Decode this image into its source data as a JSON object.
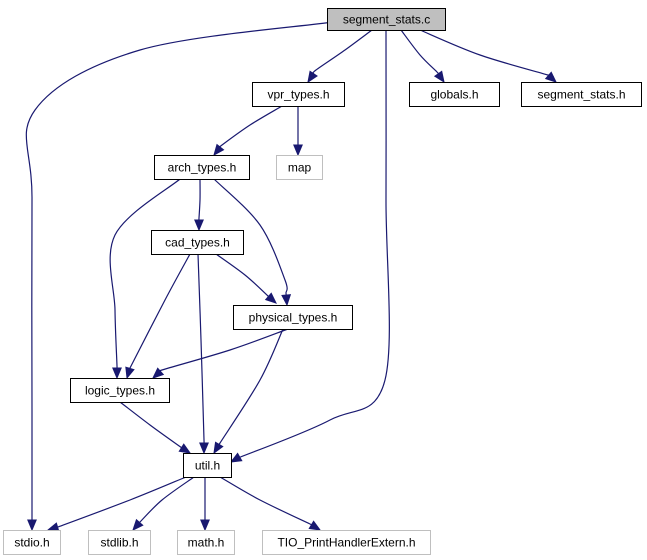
{
  "diagram": {
    "title": "",
    "edge_color": "#191970",
    "nodes": [
      {
        "id": "segment_stats_c",
        "label": "segment_stats.c",
        "style": "root",
        "fill": "#bfbfbf",
        "stroke": "#000000"
      },
      {
        "id": "vpr_types_h",
        "label": "vpr_types.h",
        "style": "doc",
        "fill": "#ffffff",
        "stroke": "#000000"
      },
      {
        "id": "globals_h",
        "label": "globals.h",
        "style": "doc",
        "fill": "#ffffff",
        "stroke": "#000000"
      },
      {
        "id": "segment_stats_h",
        "label": "segment_stats.h",
        "style": "doc",
        "fill": "#ffffff",
        "stroke": "#000000"
      },
      {
        "id": "arch_types_h",
        "label": "arch_types.h",
        "style": "doc",
        "fill": "#ffffff",
        "stroke": "#000000"
      },
      {
        "id": "map",
        "label": "map",
        "style": "external",
        "fill": "#ffffff",
        "stroke": "#bfbfbf"
      },
      {
        "id": "cad_types_h",
        "label": "cad_types.h",
        "style": "doc",
        "fill": "#ffffff",
        "stroke": "#000000"
      },
      {
        "id": "physical_types_h",
        "label": "physical_types.h",
        "style": "doc",
        "fill": "#ffffff",
        "stroke": "#000000"
      },
      {
        "id": "logic_types_h",
        "label": "logic_types.h",
        "style": "doc",
        "fill": "#ffffff",
        "stroke": "#000000"
      },
      {
        "id": "util_h",
        "label": "util.h",
        "style": "doc",
        "fill": "#ffffff",
        "stroke": "#000000"
      },
      {
        "id": "stdio_h",
        "label": "stdio.h",
        "style": "external",
        "fill": "#ffffff",
        "stroke": "#bfbfbf"
      },
      {
        "id": "stdlib_h",
        "label": "stdlib.h",
        "style": "external",
        "fill": "#ffffff",
        "stroke": "#bfbfbf"
      },
      {
        "id": "math_h",
        "label": "math.h",
        "style": "external",
        "fill": "#ffffff",
        "stroke": "#bfbfbf"
      },
      {
        "id": "tio_h",
        "label": "TIO_PrintHandlerExtern.h",
        "style": "external",
        "fill": "#ffffff",
        "stroke": "#bfbfbf"
      }
    ],
    "edges": [
      {
        "from": "segment_stats_c",
        "to": "vpr_types_h"
      },
      {
        "from": "segment_stats_c",
        "to": "globals_h"
      },
      {
        "from": "segment_stats_c",
        "to": "segment_stats_h"
      },
      {
        "from": "segment_stats_c",
        "to": "util_h"
      },
      {
        "from": "segment_stats_c",
        "to": "stdio_h"
      },
      {
        "from": "vpr_types_h",
        "to": "arch_types_h"
      },
      {
        "from": "vpr_types_h",
        "to": "map"
      },
      {
        "from": "arch_types_h",
        "to": "cad_types_h"
      },
      {
        "from": "arch_types_h",
        "to": "physical_types_h"
      },
      {
        "from": "arch_types_h",
        "to": "logic_types_h"
      },
      {
        "from": "cad_types_h",
        "to": "physical_types_h"
      },
      {
        "from": "cad_types_h",
        "to": "logic_types_h"
      },
      {
        "from": "cad_types_h",
        "to": "util_h"
      },
      {
        "from": "physical_types_h",
        "to": "logic_types_h"
      },
      {
        "from": "physical_types_h",
        "to": "util_h"
      },
      {
        "from": "logic_types_h",
        "to": "util_h"
      },
      {
        "from": "util_h",
        "to": "stdio_h"
      },
      {
        "from": "util_h",
        "to": "stdlib_h"
      },
      {
        "from": "util_h",
        "to": "math_h"
      },
      {
        "from": "util_h",
        "to": "tio_h"
      }
    ]
  }
}
